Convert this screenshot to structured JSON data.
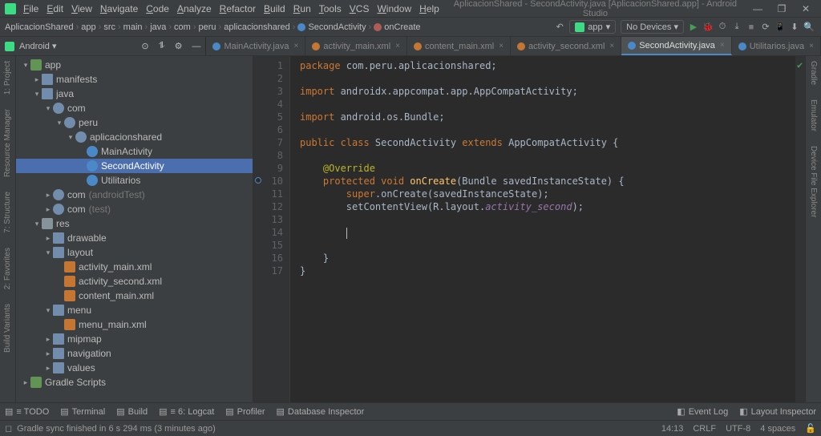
{
  "window": {
    "title": "AplicacionShared - SecondActivity.java [AplicacionShared.app] - Android Studio"
  },
  "menu": [
    "File",
    "Edit",
    "View",
    "Navigate",
    "Code",
    "Analyze",
    "Refactor",
    "Build",
    "Run",
    "Tools",
    "VCS",
    "Window",
    "Help"
  ],
  "breadcrumb": [
    "AplicacionShared",
    "app",
    "src",
    "main",
    "java",
    "com",
    "peru",
    "aplicacionshared",
    "SecondActivity",
    "onCreate"
  ],
  "run": {
    "config": "app",
    "device": "No Devices ▾"
  },
  "project_dropdown": "Android ▾",
  "tabs": [
    {
      "label": "MainActivity.java",
      "kind": "java",
      "active": false
    },
    {
      "label": "activity_main.xml",
      "kind": "xml",
      "active": false
    },
    {
      "label": "content_main.xml",
      "kind": "xml",
      "active": false
    },
    {
      "label": "activity_second.xml",
      "kind": "xml",
      "active": false
    },
    {
      "label": "SecondActivity.java",
      "kind": "java",
      "active": true
    },
    {
      "label": "Utilitarios.java",
      "kind": "java",
      "active": false
    }
  ],
  "left_tools": [
    "1: Project",
    "Resource Manager",
    "7: Structure",
    "2: Favorites",
    "Build Variants"
  ],
  "right_tools": [
    "Gradle",
    "Emulator",
    "Device File Explorer"
  ],
  "tree": [
    {
      "d": 0,
      "a": "▾",
      "i": "mod",
      "t": "app"
    },
    {
      "d": 1,
      "a": "▸",
      "i": "folder",
      "t": "manifests"
    },
    {
      "d": 1,
      "a": "▾",
      "i": "folder",
      "t": "java"
    },
    {
      "d": 2,
      "a": "▾",
      "i": "pkg",
      "t": "com"
    },
    {
      "d": 3,
      "a": "▾",
      "i": "pkg",
      "t": "peru"
    },
    {
      "d": 4,
      "a": "▾",
      "i": "pkg",
      "t": "aplicacionshared"
    },
    {
      "d": 5,
      "a": "",
      "i": "cls",
      "t": "MainActivity"
    },
    {
      "d": 5,
      "a": "",
      "i": "cls",
      "t": "SecondActivity",
      "sel": true
    },
    {
      "d": 5,
      "a": "",
      "i": "cls",
      "t": "Utilitarios"
    },
    {
      "d": 2,
      "a": "▸",
      "i": "pkg",
      "t": "com",
      "n": "(androidTest)"
    },
    {
      "d": 2,
      "a": "▸",
      "i": "pkg",
      "t": "com",
      "n": "(test)"
    },
    {
      "d": 1,
      "a": "▾",
      "i": "folderg",
      "t": "res"
    },
    {
      "d": 2,
      "a": "▸",
      "i": "folder",
      "t": "drawable"
    },
    {
      "d": 2,
      "a": "▾",
      "i": "folder",
      "t": "layout"
    },
    {
      "d": 3,
      "a": "",
      "i": "xml",
      "t": "activity_main.xml"
    },
    {
      "d": 3,
      "a": "",
      "i": "xml",
      "t": "activity_second.xml"
    },
    {
      "d": 3,
      "a": "",
      "i": "xml",
      "t": "content_main.xml"
    },
    {
      "d": 2,
      "a": "▾",
      "i": "folder",
      "t": "menu"
    },
    {
      "d": 3,
      "a": "",
      "i": "xml",
      "t": "menu_main.xml"
    },
    {
      "d": 2,
      "a": "▸",
      "i": "folder",
      "t": "mipmap"
    },
    {
      "d": 2,
      "a": "▸",
      "i": "folder",
      "t": "navigation"
    },
    {
      "d": 2,
      "a": "▸",
      "i": "folder",
      "t": "values"
    },
    {
      "d": 0,
      "a": "▸",
      "i": "mod",
      "t": "Gradle Scripts"
    }
  ],
  "code": {
    "lines": [
      [
        {
          "c": "kw",
          "t": "package "
        },
        {
          "c": "plain",
          "t": "com.peru.aplicacionshared;"
        }
      ],
      [],
      [
        {
          "c": "kw",
          "t": "import "
        },
        {
          "c": "plain",
          "t": "androidx.appcompat.app.AppCompatActivity;"
        }
      ],
      [],
      [
        {
          "c": "kw",
          "t": "import "
        },
        {
          "c": "plain",
          "t": "android.os.Bundle;"
        }
      ],
      [],
      [
        {
          "c": "kw",
          "t": "public class "
        },
        {
          "c": "typ",
          "t": "SecondActivity "
        },
        {
          "c": "kw",
          "t": "extends "
        },
        {
          "c": "typ",
          "t": "AppCompatActivity "
        },
        {
          "c": "plain",
          "t": "{"
        }
      ],
      [],
      [
        {
          "c": "plain",
          "t": "    "
        },
        {
          "c": "ann",
          "t": "@Override"
        }
      ],
      [
        {
          "c": "plain",
          "t": "    "
        },
        {
          "c": "kw",
          "t": "protected void "
        },
        {
          "c": "fn",
          "t": "onCreate"
        },
        {
          "c": "plain",
          "t": "(Bundle savedInstanceState) {"
        }
      ],
      [
        {
          "c": "plain",
          "t": "        "
        },
        {
          "c": "kw",
          "t": "super"
        },
        {
          "c": "plain",
          "t": ".onCreate(savedInstanceState);"
        }
      ],
      [
        {
          "c": "plain",
          "t": "        setContentView(R.layout."
        },
        {
          "c": "fld",
          "t": "activity_second"
        },
        {
          "c": "plain",
          "t": ");"
        }
      ],
      [],
      [
        {
          "c": "plain",
          "t": "        "
        },
        {
          "c": "caret",
          "t": ""
        }
      ],
      [],
      [
        {
          "c": "plain",
          "t": "    }"
        }
      ],
      [
        {
          "c": "plain",
          "t": "}"
        }
      ]
    ]
  },
  "bottom_tools": [
    "≡ TODO",
    "Terminal",
    "Build",
    "≡ 6: Logcat",
    "Profiler",
    "Database Inspector"
  ],
  "bottom_right": [
    "Event Log",
    "Layout Inspector"
  ],
  "status": {
    "msg": "Gradle sync finished in 6 s 294 ms (3 minutes ago)",
    "pos": "14:13",
    "eol": "CRLF",
    "enc": "UTF-8",
    "indent": "4 spaces"
  }
}
